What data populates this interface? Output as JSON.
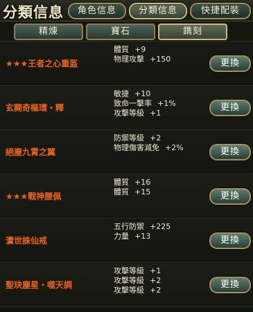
{
  "title": "分類信息",
  "top_tabs": [
    {
      "label": "角色信息"
    },
    {
      "label": "分類信息"
    },
    {
      "label": "快捷配裝"
    }
  ],
  "sub_tabs": [
    {
      "label": "精煉"
    },
    {
      "label": "寶石"
    },
    {
      "label": "鐫刻"
    }
  ],
  "active_top_tab": "分類信息",
  "active_sub_tab": "鐫刻",
  "colors": {
    "item_name": "#e8641c",
    "attr_text": "#f0ead2"
  },
  "items": [
    {
      "name": "★★★王者之心重盔",
      "attrs": [
        {
          "k": "體質",
          "v": "+9"
        },
        {
          "k": "物理攻擊",
          "v": "+150"
        }
      ],
      "button": "更換"
    },
    {
      "name": "玄闕奇樞環・釋",
      "attrs": [
        {
          "k": "敏捷",
          "v": "+10"
        },
        {
          "k": "致命一擊率",
          "v": "+1%"
        },
        {
          "k": "攻擊等級",
          "v": "+1"
        }
      ],
      "button": "更換"
    },
    {
      "name": "絕塵九霄之翼",
      "attrs": [
        {
          "k": "防禦等級",
          "v": "+2"
        },
        {
          "k": "物理傷害減免",
          "v": "+2%"
        }
      ],
      "button": "更換"
    },
    {
      "name": "★★★戰神腰佩",
      "attrs": [
        {
          "k": "體質",
          "v": "+16"
        },
        {
          "k": "體質",
          "v": "+15"
        }
      ],
      "button": "更換"
    },
    {
      "name": "瀆世誅仙戒",
      "attrs": [
        {
          "k": "五行防禦",
          "v": "+225"
        },
        {
          "k": "力量",
          "v": "+13"
        }
      ],
      "button": "更換"
    },
    {
      "name": "聖玦塵星・噬天調",
      "attrs": [
        {
          "k": "攻擊等級",
          "v": "+1"
        },
        {
          "k": "攻擊等級",
          "v": "+2"
        },
        {
          "k": "攻擊等級",
          "v": "+2"
        }
      ],
      "button": "更換"
    }
  ]
}
